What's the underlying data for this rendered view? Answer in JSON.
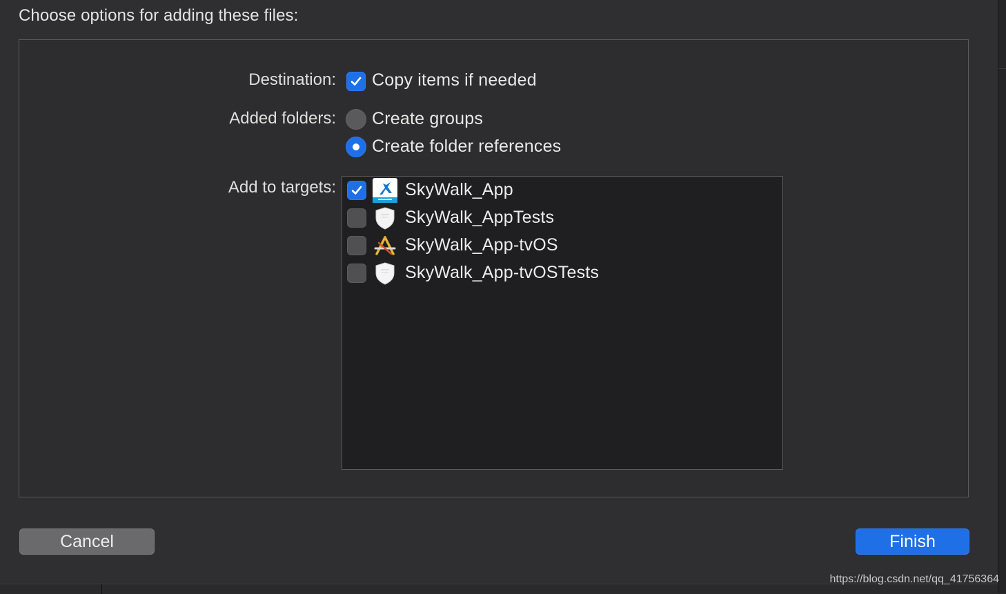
{
  "dialog": {
    "header": "Choose options for adding these files:"
  },
  "destination": {
    "label": "Destination:",
    "copy_items": {
      "label": "Copy items if needed",
      "checked": true
    }
  },
  "added_folders": {
    "label": "Added folders:",
    "options": [
      {
        "label": "Create groups",
        "selected": false
      },
      {
        "label": "Create folder references",
        "selected": true
      }
    ]
  },
  "targets": {
    "label": "Add to targets:",
    "items": [
      {
        "name": "SkyWalk_App",
        "checked": true,
        "icon": "app-icon"
      },
      {
        "name": "SkyWalk_AppTests",
        "checked": false,
        "icon": "test-shield-icon"
      },
      {
        "name": "SkyWalk_App-tvOS",
        "checked": false,
        "icon": "app-store-icon"
      },
      {
        "name": "SkyWalk_App-tvOSTests",
        "checked": false,
        "icon": "test-shield-icon"
      }
    ]
  },
  "buttons": {
    "cancel": "Cancel",
    "finish": "Finish"
  },
  "watermark": "https://blog.csdn.net/qq_41756364",
  "colors": {
    "accent": "#1f6fe6",
    "background": "#2f2f31",
    "list_background": "#1f1f21"
  }
}
